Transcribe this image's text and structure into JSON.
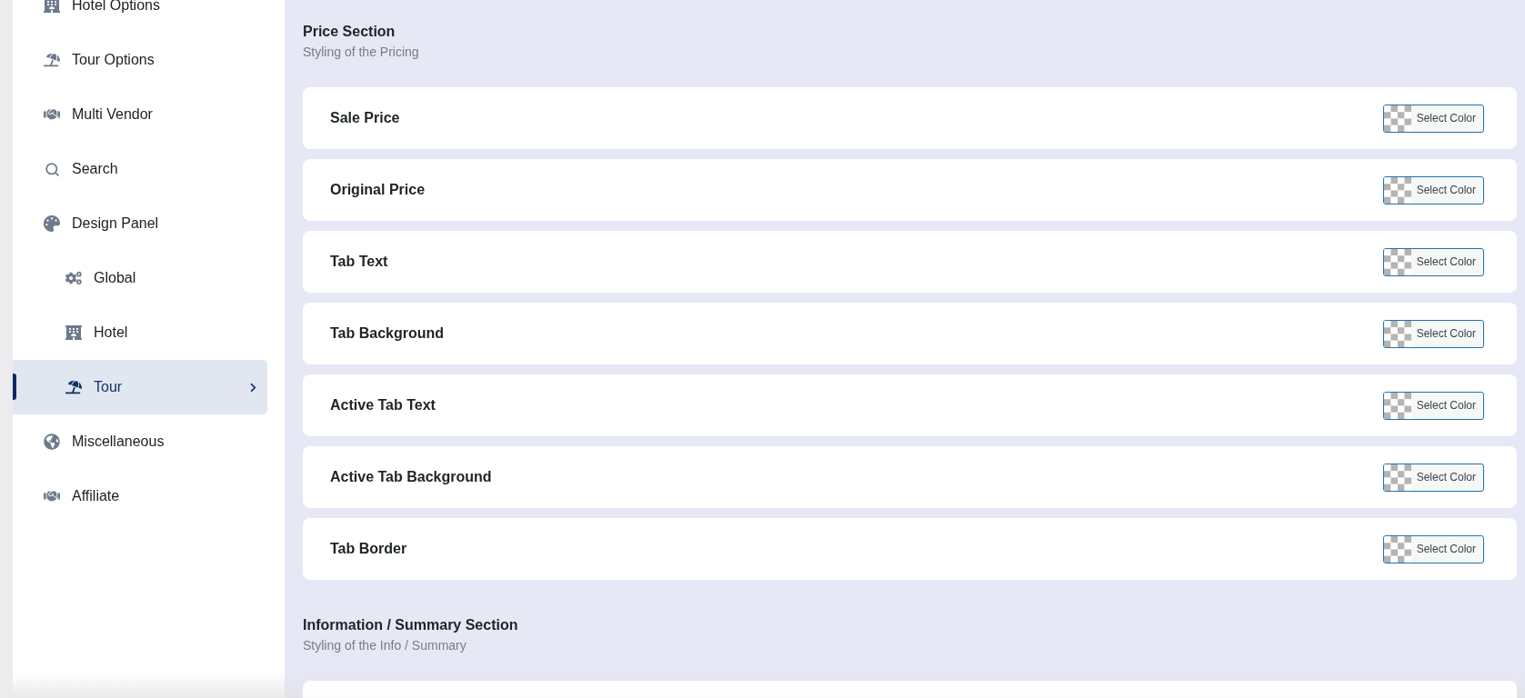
{
  "sidebar": {
    "items": [
      {
        "label": "Hotel Options",
        "selected": false
      },
      {
        "label": "Tour Options",
        "selected": false
      },
      {
        "label": "Multi Vendor",
        "selected": false
      },
      {
        "label": "Search",
        "selected": false
      },
      {
        "label": "Design Panel",
        "selected": false,
        "children": [
          {
            "label": "Global",
            "selected": false
          },
          {
            "label": "Hotel",
            "selected": false
          },
          {
            "label": "Tour",
            "selected": true
          }
        ]
      },
      {
        "label": "Miscellaneous",
        "selected": false
      },
      {
        "label": "Affiliate",
        "selected": false
      }
    ]
  },
  "sections": [
    {
      "title": "Price Section",
      "subtitle": "Styling of the Pricing",
      "fields": [
        {
          "label": "Sale Price",
          "button": "Select Color"
        },
        {
          "label": "Original Price",
          "button": "Select Color"
        },
        {
          "label": "Tab Text",
          "button": "Select Color"
        },
        {
          "label": "Tab Background",
          "button": "Select Color"
        },
        {
          "label": "Active Tab Text",
          "button": "Select Color"
        },
        {
          "label": "Active Tab Background",
          "button": "Select Color"
        },
        {
          "label": "Tab Border",
          "button": "Select Color"
        }
      ]
    },
    {
      "title": "Information / Summary Section",
      "subtitle": "Styling of the Info / Summary"
    }
  ]
}
